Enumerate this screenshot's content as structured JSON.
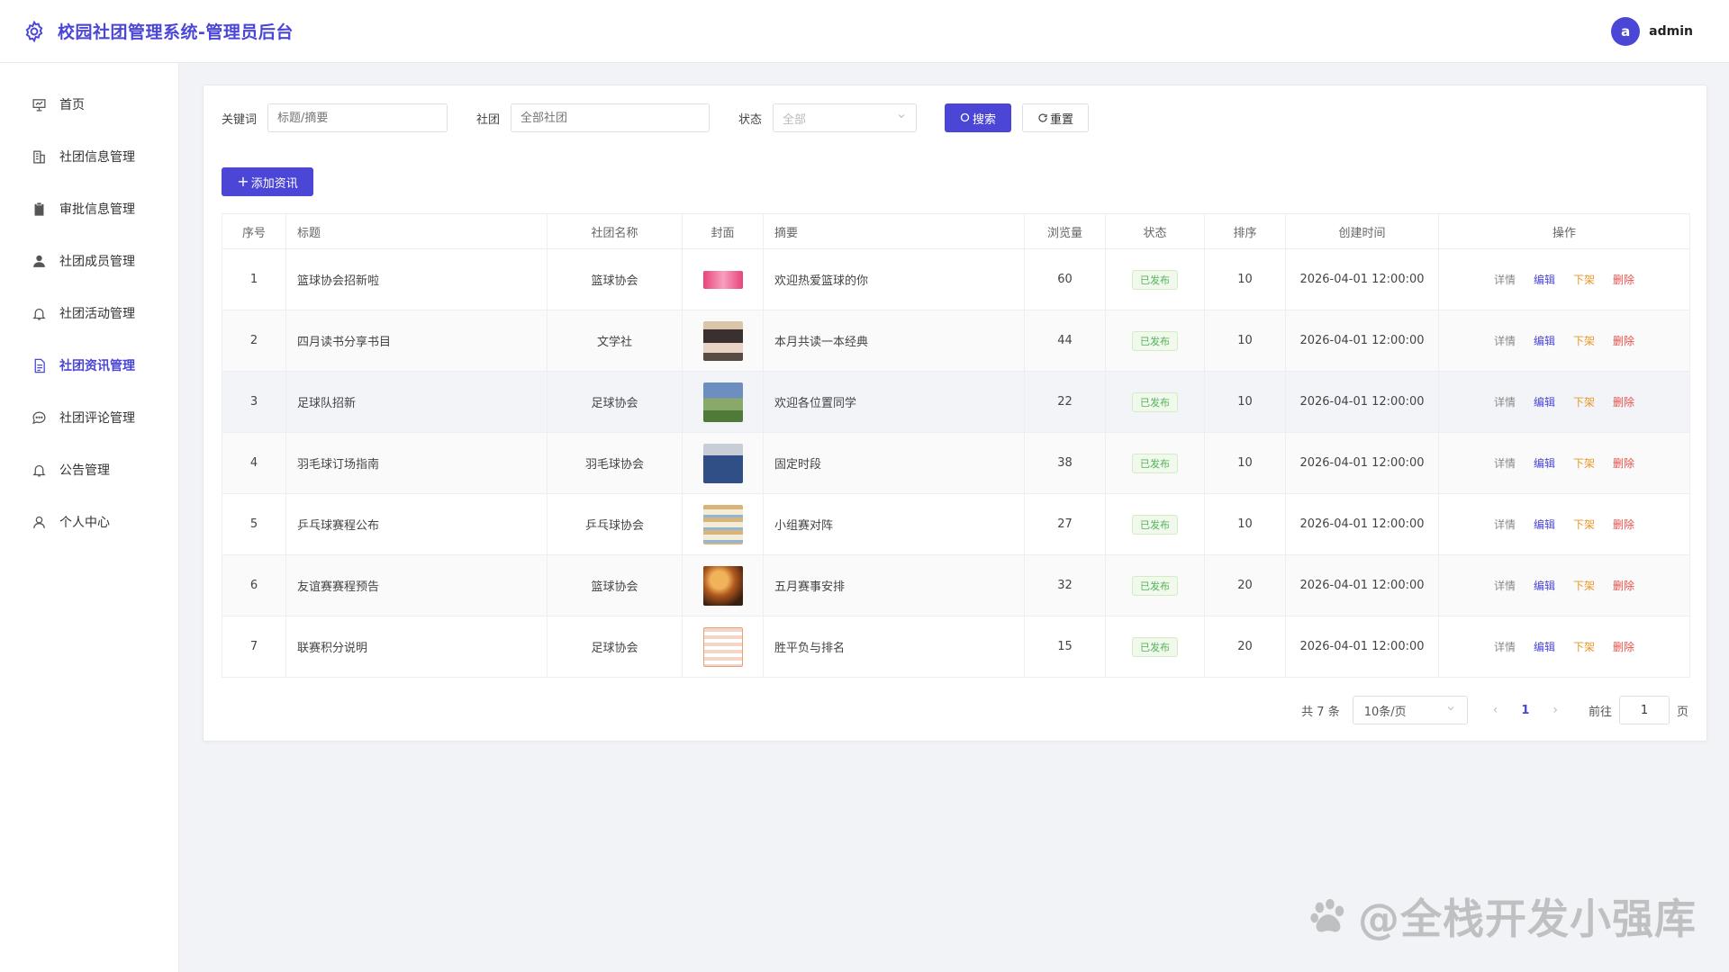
{
  "header": {
    "title": "校园社团管理系统-管理员后台",
    "avatar_letter": "a",
    "username": "admin"
  },
  "sidebar": {
    "items": [
      {
        "label": "首页",
        "icon": "presentation-icon"
      },
      {
        "label": "社团信息管理",
        "icon": "building-icon"
      },
      {
        "label": "审批信息管理",
        "icon": "clipboard-icon"
      },
      {
        "label": "社团成员管理",
        "icon": "user-icon"
      },
      {
        "label": "社团活动管理",
        "icon": "bell-icon"
      },
      {
        "label": "社团资讯管理",
        "icon": "document-icon",
        "active": true
      },
      {
        "label": "社团评论管理",
        "icon": "chat-icon"
      },
      {
        "label": "公告管理",
        "icon": "bell-icon"
      },
      {
        "label": "个人中心",
        "icon": "person-outline-icon"
      }
    ]
  },
  "filters": {
    "keyword_label": "关键词",
    "keyword_placeholder": "标题/摘要",
    "club_label": "社团",
    "club_placeholder": "全部社团",
    "status_label": "状态",
    "status_value": "全部",
    "search_label": "搜索",
    "reset_label": "重置"
  },
  "add_button_label": "添加资讯",
  "table": {
    "headers": [
      "序号",
      "标题",
      "社团名称",
      "封面",
      "摘要",
      "浏览量",
      "状态",
      "排序",
      "创建时间",
      "操作"
    ],
    "rows": [
      {
        "no": "1",
        "title": "篮球协会招新啦",
        "club": "篮球协会",
        "summary": "欢迎热爱篮球的你",
        "views": "60",
        "status": "已发布",
        "sort": "10",
        "created": "2026-04-01 12:00:00"
      },
      {
        "no": "2",
        "title": "四月读书分享书目",
        "club": "文学社",
        "summary": "本月共读一本经典",
        "views": "44",
        "status": "已发布",
        "sort": "10",
        "created": "2026-04-01 12:00:00"
      },
      {
        "no": "3",
        "title": "足球队招新",
        "club": "足球协会",
        "summary": "欢迎各位置同学",
        "views": "22",
        "status": "已发布",
        "sort": "10",
        "created": "2026-04-01 12:00:00"
      },
      {
        "no": "4",
        "title": "羽毛球订场指南",
        "club": "羽毛球协会",
        "summary": "固定时段",
        "views": "38",
        "status": "已发布",
        "sort": "10",
        "created": "2026-04-01 12:00:00"
      },
      {
        "no": "5",
        "title": "乒乓球赛程公布",
        "club": "乒乓球协会",
        "summary": "小组赛对阵",
        "views": "27",
        "status": "已发布",
        "sort": "10",
        "created": "2026-04-01 12:00:00"
      },
      {
        "no": "6",
        "title": "友谊赛赛程预告",
        "club": "篮球协会",
        "summary": "五月赛事安排",
        "views": "32",
        "status": "已发布",
        "sort": "20",
        "created": "2026-04-01 12:00:00"
      },
      {
        "no": "7",
        "title": "联赛积分说明",
        "club": "足球协会",
        "summary": "胜平负与排名",
        "views": "15",
        "status": "已发布",
        "sort": "20",
        "created": "2026-04-01 12:00:00"
      }
    ],
    "ops": {
      "detail": "详情",
      "edit": "编辑",
      "off": "下架",
      "delete": "删除"
    }
  },
  "pagination": {
    "total_text": "共 7 条",
    "page_size": "10条/页",
    "current_page": "1",
    "goto_label": "前往",
    "goto_value": "1",
    "page_suffix": "页"
  },
  "watermark": "@全栈开发小强库",
  "colors": {
    "accent": "#4b46d6",
    "success": "#52b35a",
    "warning": "#e59a2a",
    "danger": "#e8504a"
  }
}
